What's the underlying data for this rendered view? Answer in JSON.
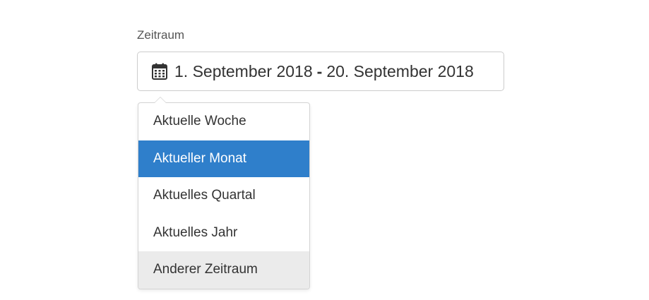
{
  "field": {
    "label": "Zeitraum"
  },
  "range": {
    "icon": "calendar-icon",
    "start": "1. September 2018",
    "separator": "-",
    "end": "20. September 2018"
  },
  "menu": {
    "items": [
      {
        "label": "Aktuelle Woche",
        "state": "normal"
      },
      {
        "label": "Aktueller Monat",
        "state": "selected"
      },
      {
        "label": "Aktuelles Quartal",
        "state": "normal"
      },
      {
        "label": "Aktuelles Jahr",
        "state": "normal"
      },
      {
        "label": "Anderer Zeitraum",
        "state": "hover"
      }
    ]
  },
  "colors": {
    "selected_background": "#2f7fcb",
    "hover_background": "#ebebeb",
    "border": "#cccccc",
    "text": "#333333"
  }
}
